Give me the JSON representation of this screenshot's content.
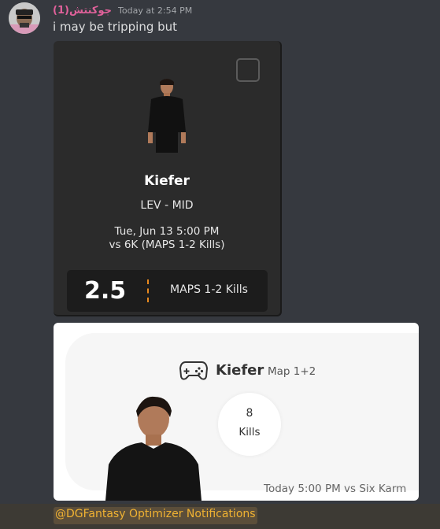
{
  "message": {
    "username": "جوكنتش(1)",
    "timestamp": "Today at 2:54 PM",
    "text": "i may be tripping but"
  },
  "card1": {
    "player_name": "Kiefer",
    "team_position": "LEV - MID",
    "datetime": "Tue, Jun 13 5:00 PM",
    "opponent": "vs 6K (MAPS 1-2 Kills)",
    "line_value": "2.5",
    "stat_label": "MAPS 1-2 Kills"
  },
  "card2": {
    "icon": "gamepad-icon",
    "player_name": "Kiefer",
    "map": "Map 1+2",
    "kills_value": "8",
    "kills_label": "Kills",
    "game_time": "Today 5:00 PM vs Six Karm"
  },
  "mention": {
    "text": "@DGFantasy Optimizer Notifications"
  },
  "colors": {
    "background": "#36393f",
    "username": "#e0619a",
    "card_dark": "#2b2b2b",
    "accent_orange": "#e8891e",
    "mention_text": "#f0b232"
  }
}
